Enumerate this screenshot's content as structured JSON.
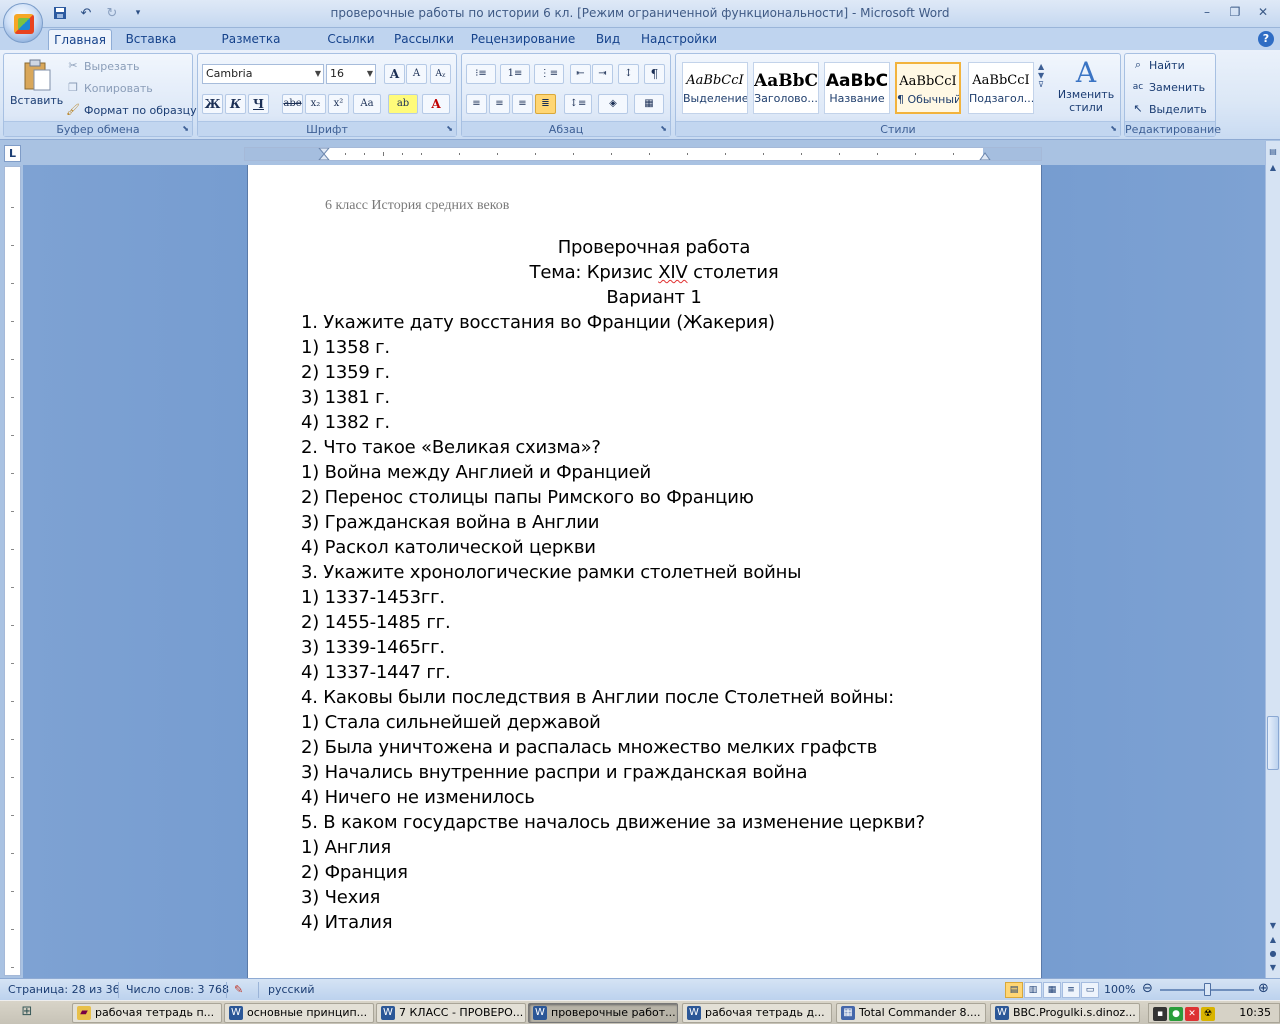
{
  "window": {
    "title": "проверочные работы по истории 6 кл. [Режим ограниченной функциональности] - Microsoft Word",
    "minimize": "–",
    "maximize": "❐",
    "close": "✕"
  },
  "qat": {
    "save_icon": "save-icon",
    "undo_icon": "undo-icon",
    "redo_icon": "redo-icon",
    "customize_icon": "customize-icon"
  },
  "tabs": [
    "Главная",
    "Вставка",
    "Разметка страницы",
    "Ссылки",
    "Рассылки",
    "Рецензирование",
    "Вид",
    "Надстройки"
  ],
  "ribbon": {
    "clipboard": {
      "label": "Буфер обмена",
      "paste": "Вставить",
      "cut": "Вырезать",
      "copy": "Копировать",
      "format_painter": "Формат по образцу"
    },
    "font": {
      "label": "Шрифт",
      "font_name": "Cambria",
      "font_size": "16",
      "grow": "A",
      "shrink": "A",
      "bold": "Ж",
      "italic": "К",
      "underline": "Ч",
      "strike": "abe",
      "sub": "x₂",
      "sup": "x²",
      "case": "Aa"
    },
    "paragraph": {
      "label": "Абзац"
    },
    "styles": {
      "label": "Стили",
      "items": [
        {
          "sample": "AaBbCcI",
          "name": "Выделение"
        },
        {
          "sample": "AaBbC",
          "name": "Заголово..."
        },
        {
          "sample": "AaBbC",
          "name": "Название"
        },
        {
          "sample": "AaBbCcI",
          "name": "¶ Обычный"
        },
        {
          "sample": "AaBbCcI",
          "name": "Подзагол..."
        }
      ],
      "change_styles": "Изменить стили"
    },
    "editing": {
      "label": "Редактирование",
      "find": "Найти",
      "replace": "Заменить",
      "select": "Выделить"
    }
  },
  "document": {
    "header": "6 класс   История средних веков",
    "title": "Проверочная работа",
    "topic_prefix": "Тема: Кризис ",
    "topic_century": "XIV",
    "topic_suffix": " столетия",
    "variant": "Вариант 1",
    "lines": [
      "1. Укажите дату восстания во Франции (Жакерия)",
      "1) 1358 г.",
      "2) 1359 г.",
      "3) 1381 г.",
      "4) 1382 г.",
      "2. Что такое «Великая схизма»?",
      "1) Война между Англией и Францией",
      "2) Перенос столицы папы Римского во Францию",
      "3) Гражданская война в Англии",
      "4) Раскол католической церкви",
      "3. Укажите хронологические рамки столетней войны",
      "1) 1337-1453гг.",
      "2) 1455-1485 гг.",
      "3) 1339-1465гг.",
      "4) 1337-1447 гг.",
      "4. Каковы были  последствия в Англии после Столетней войны:",
      "1) Стала сильнейшей державой",
      "2) Была уничтожена и распалась множество мелких графств",
      "3) Начались внутренние распри и гражданская война",
      "4) Ничего не изменилось",
      "5. В каком государстве началось движение за изменение церкви?",
      "1) Англия",
      "2) Франция",
      "3) Чехия",
      "4) Италия"
    ]
  },
  "status": {
    "page": "Страница: 28 из 36",
    "words": "Число слов: 3 768",
    "language": "русский",
    "zoom": "100%",
    "zoom_level": 100
  },
  "taskbar": {
    "tasks": [
      {
        "label": "рабочая тетрадь п...",
        "icon": "folder"
      },
      {
        "label": "основные принцип...",
        "icon": "word"
      },
      {
        "label": "7 КЛАСС - ПРОВЕРО...",
        "icon": "word"
      },
      {
        "label": "проверочные работ...",
        "icon": "word",
        "active": true
      },
      {
        "label": "рабочая тетрадь д...",
        "icon": "word"
      },
      {
        "label": "Total Commander 8....",
        "icon": "tc"
      },
      {
        "label": "BBC.Progulki.s.dinoz...",
        "icon": "word"
      }
    ],
    "clock": "10:35"
  }
}
